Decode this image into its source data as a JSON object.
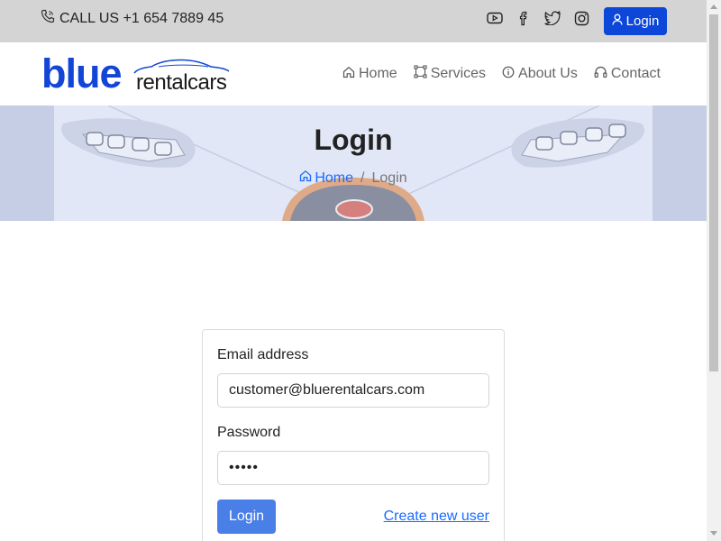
{
  "topbar": {
    "phone_label": "CALL US +1 654 7889 45",
    "socials": [
      "youtube-icon",
      "facebook-icon",
      "twitter-icon",
      "instagram-icon"
    ],
    "login_label": "Login"
  },
  "brand": {
    "word1": "blue",
    "word2": "rentalcars",
    "color": "#1346d6"
  },
  "nav": {
    "items": [
      {
        "label": "Home",
        "icon": "home-icon"
      },
      {
        "label": "Services",
        "icon": "services-icon"
      },
      {
        "label": "About Us",
        "icon": "info-icon"
      },
      {
        "label": "Contact",
        "icon": "headset-icon"
      }
    ]
  },
  "hero": {
    "title": "Login",
    "breadcrumb": {
      "home": "Home",
      "separator": "/",
      "current": "Login"
    }
  },
  "form": {
    "email_label": "Email address",
    "email_value": "customer@bluerentalcars.com",
    "password_label": "Password",
    "password_value": "•••••",
    "submit_label": "Login",
    "create_link": "Create new user"
  },
  "colors": {
    "accent": "#0d47d9",
    "link": "#1a6bff",
    "submit": "#4a7fe8"
  }
}
